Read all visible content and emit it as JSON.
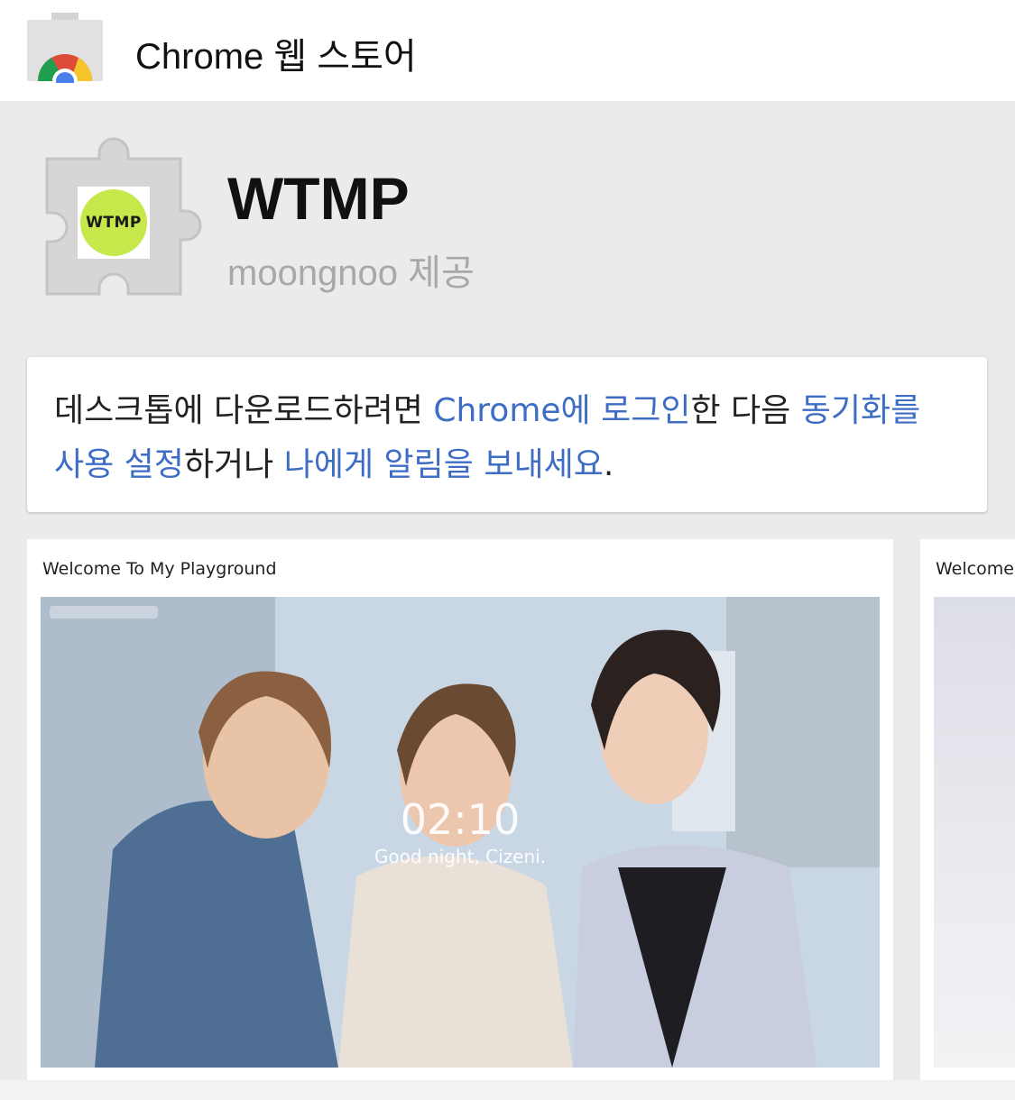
{
  "header": {
    "store_title": "Chrome 웹 스토어"
  },
  "extension": {
    "name": "WTMP",
    "author": "moongnoo 제공",
    "logo_text": "WTMP"
  },
  "notice": {
    "part1": "데스크톱에 다운로드하려면 ",
    "link1": "Chrome에 로그인",
    "part2": "한 다음 ",
    "link2": "동기화를 사용 설정",
    "part3": "하거나 ",
    "link3": "나에게 알림을 보내세요",
    "part4": "."
  },
  "screenshots": [
    {
      "title": "Welcome To My Playground",
      "clock_time": "02:10",
      "clock_greeting": "Good night, Cizeni."
    },
    {
      "title": "Welcome To My Playground"
    }
  ],
  "colors": {
    "link": "#3d6dc5",
    "background": "#ebebeb",
    "logo_green": "#c6e84a"
  }
}
